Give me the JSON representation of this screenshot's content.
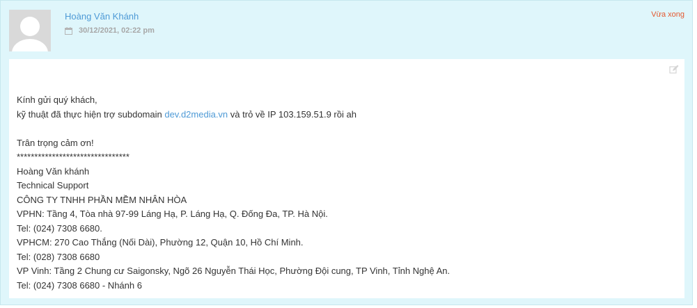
{
  "reply": {
    "author_name": "Hoàng Văn Khánh",
    "date": "30/12/2021, 02:22 pm",
    "time_ago": "Vừa xong",
    "avatar_icon": "user-silhouette-icon",
    "date_icon": "calendar-icon",
    "edit_icon": "edit-icon"
  },
  "message": {
    "greeting": "Kính gửi quý khách,",
    "line2_before": "kỹ thuật đã thực hiện trợ subdomain ",
    "link_text": "dev.d2media.vn",
    "line2_after": " và trỏ về IP 103.159.51.9 rồi ah",
    "closing": "Trân trọng cảm ơn!",
    "separator": "********************************",
    "sig_name": "Hoàng Văn khánh",
    "sig_title": "Technical Support",
    "sig_company": "CÔNG TY TNHH PHẦN MỀM NHÂN HÒA",
    "sig_vphn": "VPHN: Tầng 4, Tòa nhà 97-99 Láng Hạ, P. Láng Hạ, Q. Đống Đa, TP. Hà Nội.",
    "sig_tel_hn": "Tel: (024) 7308 6680.",
    "sig_vphcm": "VPHCM: 270 Cao Thắng (Nối Dài), Phường 12, Quận 10, Hồ Chí Minh.",
    "sig_tel_hcm": "Tel: (028) 7308 6680",
    "sig_vpvinh": "VP Vinh: Tầng 2 Chung cư Saigonsky, Ngõ 26 Nguyễn Thái Học, Phường Đội cung, TP Vinh, Tỉnh Nghệ An.",
    "sig_tel_vinh": "Tel: (024) 7308 6680 - Nhánh 6"
  },
  "colors": {
    "card_bg": "#dff6fb",
    "link": "#4e9ad6",
    "time_ago": "#e4572e",
    "date_text": "#a7a7a7"
  }
}
